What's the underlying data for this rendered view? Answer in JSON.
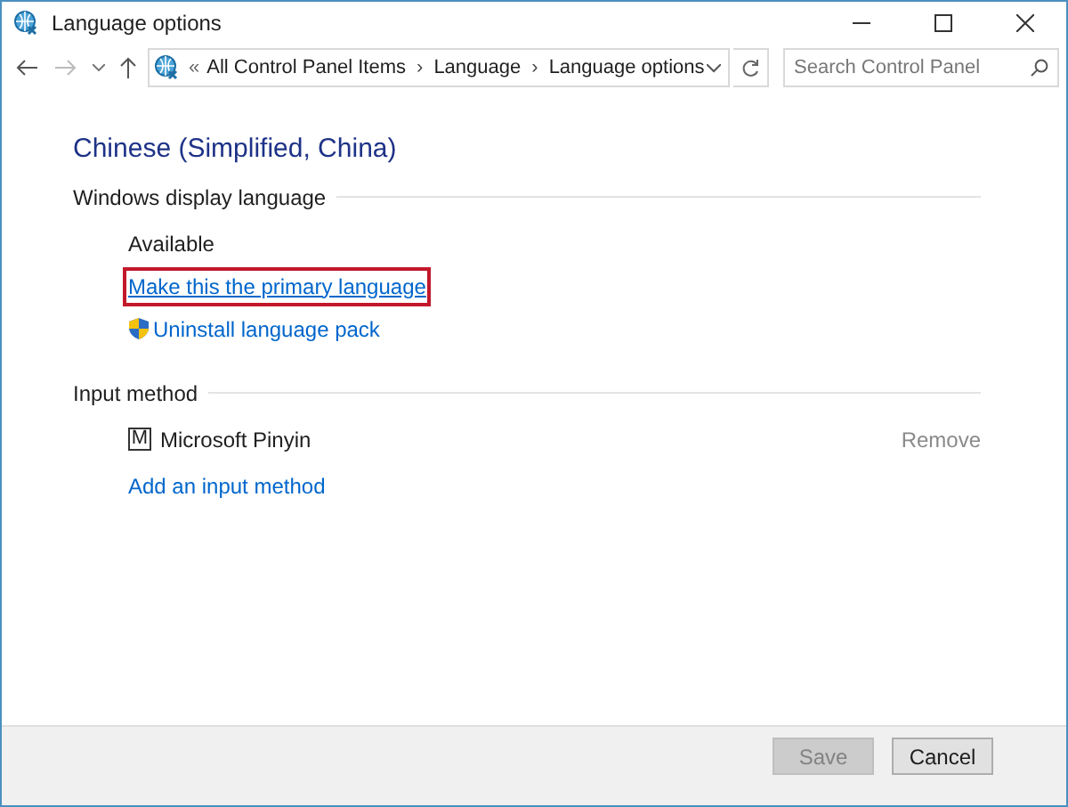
{
  "window": {
    "title": "Language options"
  },
  "address_bar": {
    "overflow": "«",
    "crumbs": [
      "All Control Panel Items",
      "Language",
      "Language options"
    ],
    "separator": "›"
  },
  "search": {
    "placeholder": "Search Control Panel"
  },
  "heading": "Chinese (Simplified, China)",
  "display_language": {
    "title": "Windows display language",
    "status": "Available",
    "links": [
      {
        "label": "Make this the primary language",
        "highlighted": true,
        "kind": "plain"
      },
      {
        "label": "Uninstall language pack",
        "highlighted": false,
        "kind": "shield"
      }
    ]
  },
  "input_method": {
    "title": "Input method",
    "items": [
      {
        "badge": "M",
        "name": "Microsoft Pinyin",
        "action": "Remove",
        "disabled": true
      }
    ],
    "add_link": "Add an input method"
  },
  "buttons": [
    {
      "label": "Save",
      "disabled": true
    },
    {
      "label": "Cancel",
      "disabled": false
    }
  ]
}
